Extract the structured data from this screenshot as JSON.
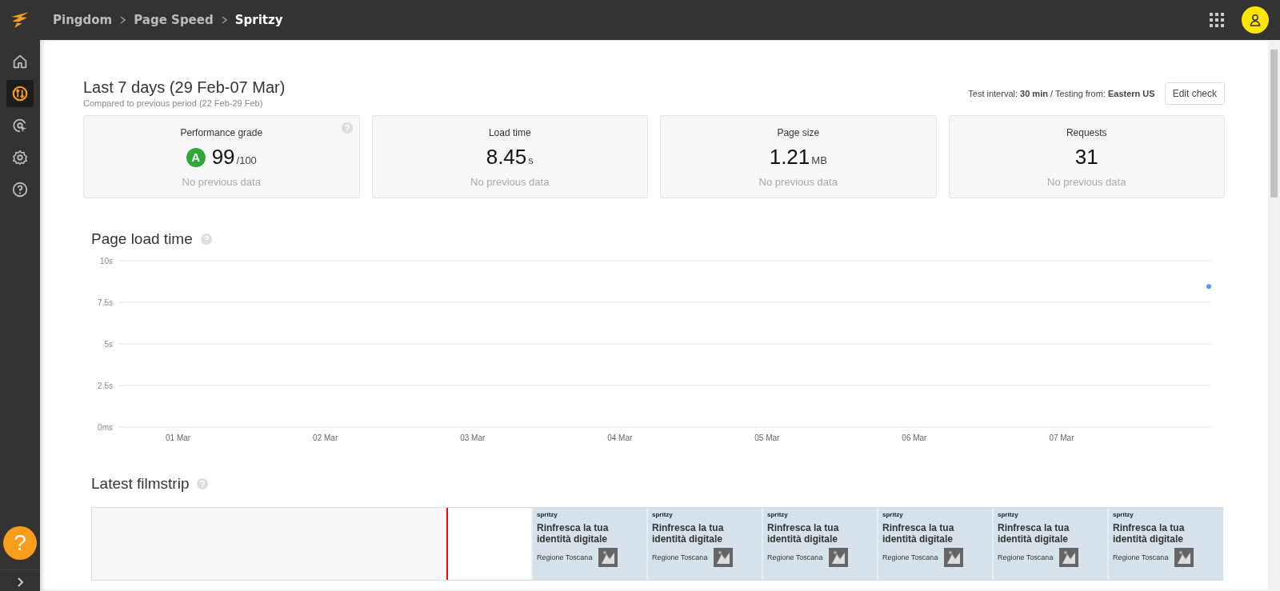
{
  "breadcrumbs": [
    {
      "label": "Pingdom",
      "current": false
    },
    {
      "label": "Page Speed",
      "current": false
    },
    {
      "label": "Spritzy",
      "current": true
    }
  ],
  "sidebar": {
    "items": [
      {
        "kind": "home",
        "selected": false
      },
      {
        "kind": "speed",
        "selected": true
      },
      {
        "kind": "target",
        "selected": false
      },
      {
        "kind": "settings",
        "selected": false
      },
      {
        "kind": "help",
        "selected": false
      }
    ],
    "help_button": "?"
  },
  "header": {
    "title": "Last 7 days (29 Feb-07 Mar)",
    "subtitle": "Compared to previous period (22 Feb-29 Feb)",
    "test_info": "Test interval: **30 min** / Testing from: **Eastern US**",
    "edit_button": "Edit check"
  },
  "metrics": [
    {
      "label": "Performance grade",
      "grade": "A",
      "value": "99",
      "unit": "/100",
      "note": "No previous data",
      "help": true
    },
    {
      "label": "Load time",
      "value": "8.45",
      "unit": "s",
      "note": "No previous data",
      "help": false
    },
    {
      "label": "Page size",
      "value": "1.21",
      "unit": "MB",
      "note": "No previous data",
      "help": false
    },
    {
      "label": "Requests",
      "value": "31",
      "note": "No previous data",
      "help": false
    }
  ],
  "load_chart": {
    "title": "Page load time",
    "chart_data": {
      "type": "scatter",
      "categories": [
        "01 Mar",
        "02 Mar",
        "03 Mar",
        "04 Mar",
        "05 Mar",
        "06 Mar",
        "07 Mar",
        null
      ],
      "series": [
        {
          "color": "#4a9fe8",
          "values": [
            null,
            null,
            null,
            null,
            null,
            null,
            null,
            8.45
          ]
        }
      ],
      "grid": true,
      "ylim": [
        0,
        10
      ],
      "yticks": [
        {
          "value": 0,
          "label": "0ms"
        },
        {
          "value": 2.5,
          "label": "2.5s"
        },
        {
          "value": 5,
          "label": "5s"
        },
        {
          "value": 7.5,
          "label": "7.5s"
        },
        {
          "value": 10,
          "label": "10s"
        }
      ]
    }
  },
  "filmstrip": {
    "title": "Latest filmstrip",
    "frames": [
      {
        "logo": "spritzy",
        "headline": "Rinfresca la tua identità digitale",
        "region": "Regione Toscana"
      },
      {
        "logo": "spritzy",
        "headline": "Rinfresca la tua identità digitale",
        "region": "Regione Toscana"
      },
      {
        "logo": "spritzy",
        "headline": "Rinfresca la tua identità digitale",
        "region": "Regione Toscana"
      },
      {
        "logo": "spritzy",
        "headline": "Rinfresca la tua identità digitale",
        "region": "Regione Toscana"
      },
      {
        "logo": "spritzy",
        "headline": "Rinfresca la tua identità digitale",
        "region": "Regione Toscana"
      },
      {
        "logo": "spritzy",
        "headline": "Rinfresca la tua identità digitale",
        "region": "Regione Toscana"
      }
    ]
  }
}
